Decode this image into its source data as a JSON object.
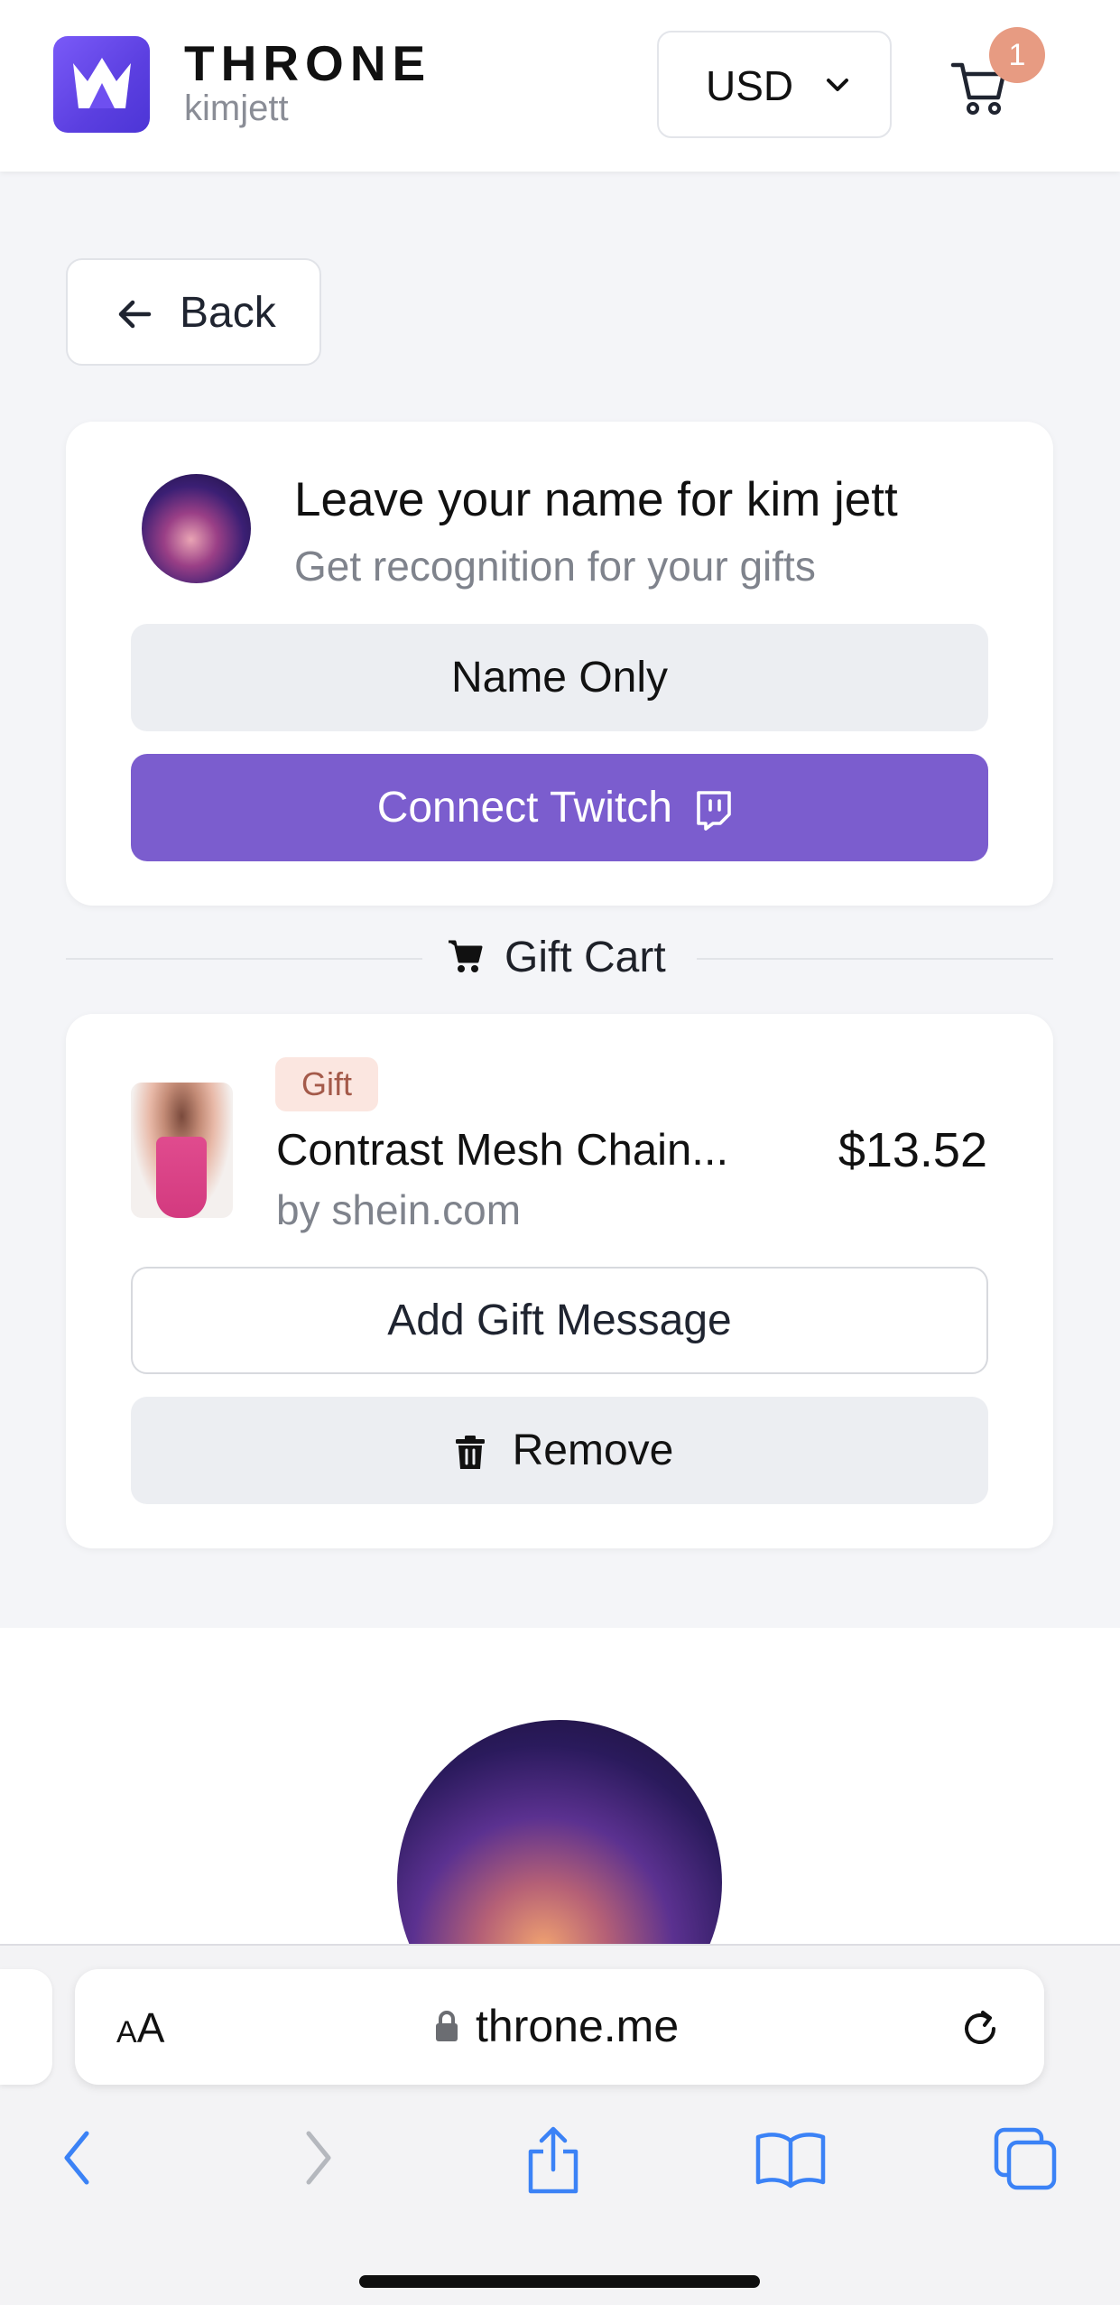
{
  "header": {
    "brand": "THRONE",
    "username": "kimjett",
    "currency": "USD",
    "cart_count": "1"
  },
  "back": {
    "label": "Back"
  },
  "name_card": {
    "title": "Leave your name for kim jett",
    "subtitle": "Get recognition for your gifts",
    "name_only_label": "Name Only",
    "connect_label": "Connect Twitch"
  },
  "divider": {
    "label": "Gift Cart"
  },
  "cart_item": {
    "tag": "Gift",
    "name": "Contrast Mesh Chain...",
    "seller": "by shein.com",
    "price": "$13.52",
    "add_message_label": "Add Gift Message",
    "remove_label": "Remove"
  },
  "browser": {
    "text_size_label_small": "A",
    "text_size_label": "A",
    "url": "throne.me"
  },
  "colors": {
    "accent_purple": "#7b5dce",
    "badge": "#e79b82",
    "tag_bg": "#fbe6e0",
    "ios_blue": "#3b82f6"
  },
  "icons": [
    "crown-logo-icon",
    "chevron-down-icon",
    "cart-icon",
    "arrow-left-icon",
    "twitch-icon",
    "cart-filled-icon",
    "trash-icon",
    "lock-icon",
    "reload-icon",
    "back-nav-icon",
    "forward-nav-icon",
    "share-icon",
    "bookmarks-icon",
    "tabs-icon"
  ]
}
